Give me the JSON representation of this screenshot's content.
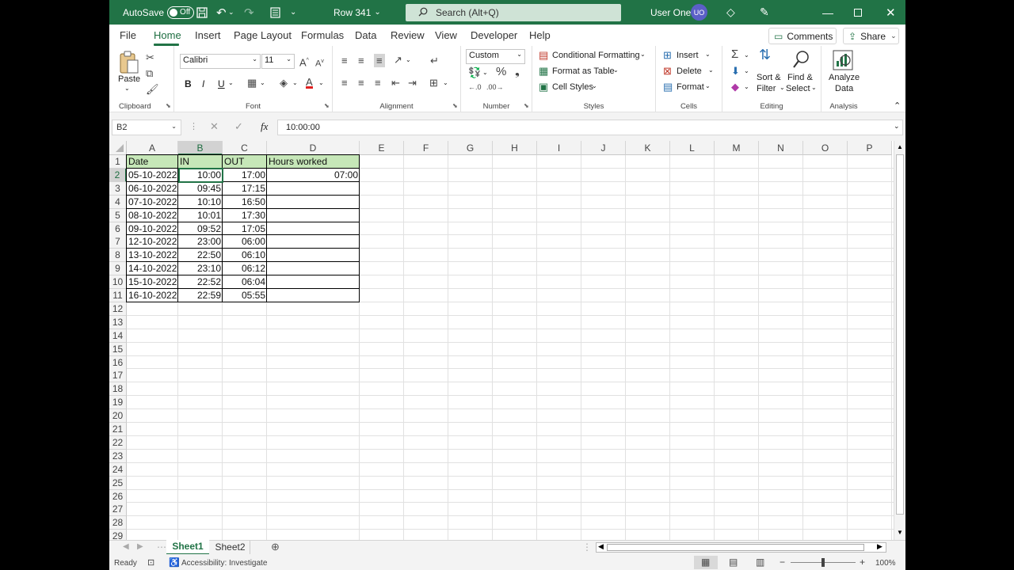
{
  "titlebar": {
    "autosave_label": "AutoSave",
    "autosave_state": "Off",
    "file_name": "Row 341",
    "search_placeholder": "Search (Alt+Q)",
    "user_name": "User One",
    "user_initials": "UO"
  },
  "tabs": [
    "File",
    "Home",
    "Insert",
    "Page Layout",
    "Formulas",
    "Data",
    "Review",
    "View",
    "Developer",
    "Help"
  ],
  "active_tab": "Home",
  "top_buttons": {
    "comments": "Comments",
    "share": "Share"
  },
  "ribbon": {
    "clipboard": {
      "label": "Clipboard",
      "paste": "Paste"
    },
    "font": {
      "label": "Font",
      "family": "Calibri",
      "size": "11",
      "bold": "B",
      "italic": "I",
      "underline": "U"
    },
    "alignment": {
      "label": "Alignment"
    },
    "number": {
      "label": "Number",
      "format": "Custom"
    },
    "styles": {
      "label": "Styles",
      "conditional": "Conditional Formatting",
      "format_table": "Format as Table",
      "cell_styles": "Cell Styles"
    },
    "cells": {
      "label": "Cells",
      "insert": "Insert",
      "delete": "Delete",
      "format": "Format"
    },
    "editing": {
      "label": "Editing",
      "sort1": "Sort &",
      "sort2": "Filter",
      "find1": "Find &",
      "find2": "Select"
    },
    "analysis": {
      "label": "Analysis",
      "analyze1": "Analyze",
      "analyze2": "Data"
    }
  },
  "formula_bar": {
    "name_box": "B2",
    "fx": "fx",
    "formula": "10:00:00"
  },
  "columns": [
    "A",
    "B",
    "C",
    "D",
    "E",
    "F",
    "G",
    "H",
    "I",
    "J",
    "K",
    "L",
    "M",
    "N",
    "O",
    "P"
  ],
  "rows": [
    "1",
    "2",
    "3",
    "4",
    "5",
    "6",
    "7",
    "8",
    "9",
    "10",
    "11",
    "12",
    "13",
    "14",
    "15",
    "16",
    "17",
    "18",
    "19",
    "20",
    "21",
    "22",
    "23",
    "24",
    "25",
    "26",
    "27",
    "28",
    "29"
  ],
  "table": {
    "headers": [
      "Date",
      "IN",
      "OUT",
      "Hours worked"
    ],
    "rows": [
      [
        "05-10-2022",
        "10:00",
        "17:00",
        "07:00"
      ],
      [
        "06-10-2022",
        "09:45",
        "17:15",
        ""
      ],
      [
        "07-10-2022",
        "10:10",
        "16:50",
        ""
      ],
      [
        "08-10-2022",
        "10:01",
        "17:30",
        ""
      ],
      [
        "09-10-2022",
        "09:52",
        "17:05",
        ""
      ],
      [
        "12-10-2022",
        "23:00",
        "06:00",
        ""
      ],
      [
        "13-10-2022",
        "22:50",
        "06:10",
        ""
      ],
      [
        "14-10-2022",
        "23:10",
        "06:12",
        ""
      ],
      [
        "15-10-2022",
        "22:52",
        "06:04",
        ""
      ],
      [
        "16-10-2022",
        "22:59",
        "05:55",
        ""
      ]
    ]
  },
  "sheets": [
    "Sheet1",
    "Sheet2"
  ],
  "active_sheet": "Sheet1",
  "status": {
    "ready": "Ready",
    "accessibility": "Accessibility: Investigate",
    "zoom": "100%"
  },
  "colors": {
    "accent": "#217346",
    "header_fill": "#c6e7b8"
  }
}
